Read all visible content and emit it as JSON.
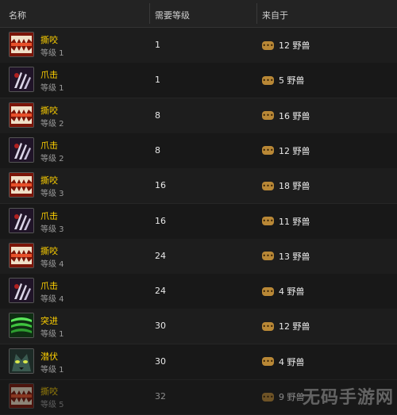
{
  "header": {
    "col_name": "名称",
    "col_level": "需要等级",
    "col_source": "来自于"
  },
  "rows": [
    {
      "name": "撕咬",
      "rank": "等级 1",
      "level": "1",
      "source": "12 野兽",
      "icon": "bite-icon"
    },
    {
      "name": "爪击",
      "rank": "等级 1",
      "level": "1",
      "source": "5 野兽",
      "icon": "claw-icon"
    },
    {
      "name": "撕咬",
      "rank": "等级 2",
      "level": "8",
      "source": "16 野兽",
      "icon": "bite-icon"
    },
    {
      "name": "爪击",
      "rank": "等级 2",
      "level": "8",
      "source": "12 野兽",
      "icon": "claw-icon"
    },
    {
      "name": "撕咬",
      "rank": "等级 3",
      "level": "16",
      "source": "18 野兽",
      "icon": "bite-icon"
    },
    {
      "name": "爪击",
      "rank": "等级 3",
      "level": "16",
      "source": "11 野兽",
      "icon": "claw-icon"
    },
    {
      "name": "撕咬",
      "rank": "等级 4",
      "level": "24",
      "source": "13 野兽",
      "icon": "bite-icon"
    },
    {
      "name": "爪击",
      "rank": "等级 4",
      "level": "24",
      "source": "4 野兽",
      "icon": "claw-icon"
    },
    {
      "name": "突进",
      "rank": "等级 1",
      "level": "30",
      "source": "12 野兽",
      "icon": "dash-icon"
    },
    {
      "name": "潜伏",
      "rank": "等级 1",
      "level": "30",
      "source": "4 野兽",
      "icon": "prowl-icon"
    },
    {
      "name": "撕咬",
      "rank": "等级 5",
      "level": "32",
      "source": "9 野兽",
      "icon": "bite-icon"
    }
  ],
  "bubble_glyph": "•••",
  "watermark": "无码手游网"
}
